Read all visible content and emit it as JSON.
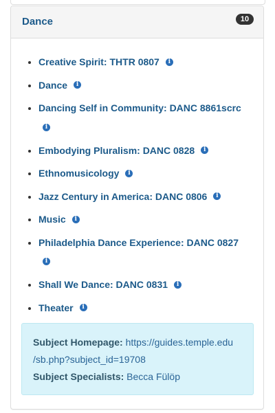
{
  "panel": {
    "title": "Dance",
    "badge": "10"
  },
  "guides": [
    {
      "label": "Creative Spirit: THTR 0807",
      "info_icon": "info-circle-icon"
    },
    {
      "label": "Dance",
      "info_icon": "info-circle-icon"
    },
    {
      "label": "Dancing Self in Community: DANC 8861scrc",
      "info_icon": "info-circle-icon"
    },
    {
      "label": "Embodying Pluralism: DANC 0828",
      "info_icon": "info-circle-icon"
    },
    {
      "label": "Ethnomusicology",
      "info_icon": "info-circle-icon"
    },
    {
      "label": "Jazz Century in America: DANC 0806",
      "info_icon": "info-circle-icon"
    },
    {
      "label": "Music",
      "info_icon": "info-circle-icon"
    },
    {
      "label": "Philadelphia Dance Experience: DANC 0827",
      "info_icon": "info-circle-icon"
    },
    {
      "label": "Shall We Dance: DANC 0831",
      "info_icon": "info-circle-icon"
    },
    {
      "label": "Theater",
      "info_icon": "info-circle-icon"
    }
  ],
  "subject_info": {
    "homepage_label": "Subject Homepage:",
    "homepage_url": "https://guides.temple.edu/sb.php?subject_id=19708",
    "homepage_url_line1": "https://guides.temple.edu",
    "homepage_url_line2": "/sb.php?subject_id=19708",
    "specialists_label": "Subject Specialists:",
    "specialist_name": "Becca Fülöp"
  },
  "colors": {
    "link": "#1c5a8a",
    "info_icon": "#2a6eb8",
    "well_background": "#d9f3fa",
    "badge_background": "#333333"
  }
}
